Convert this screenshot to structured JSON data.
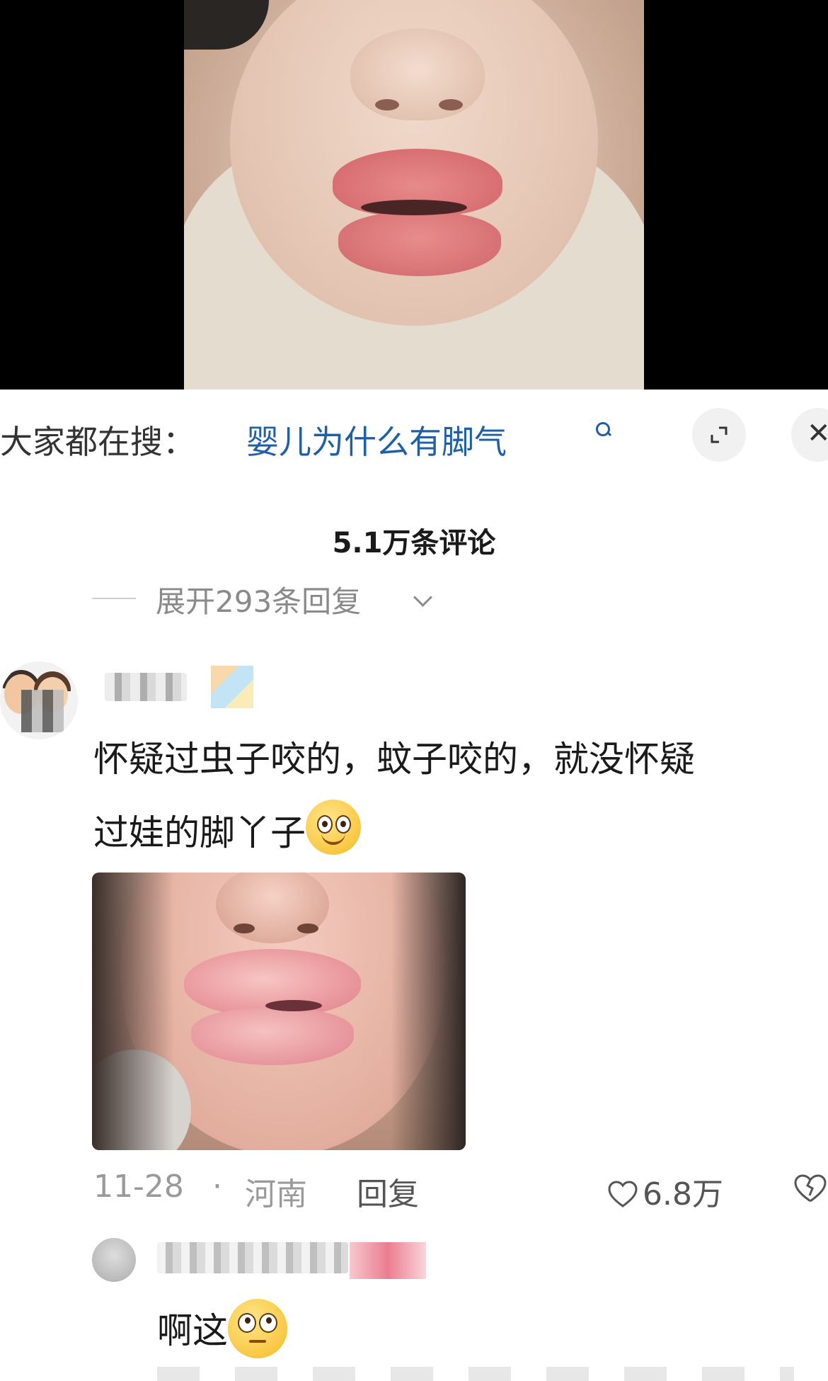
{
  "search": {
    "prefix": "大家都在搜：",
    "term": "婴儿为什么有脚气"
  },
  "comments": {
    "count_label": "5.1万条评论",
    "expand_label": "展开293条回复",
    "main": {
      "text_line1": "怀疑过虫子咬的，蚊子咬的，就没怀疑",
      "text_line2": "过娃的脚丫子",
      "date": "11-28",
      "dot": "·",
      "location": "河南",
      "reply_label": "回复",
      "likes": "6.8万"
    },
    "reply": {
      "text": "啊这"
    }
  },
  "icons": {
    "search": "search-icon",
    "expand": "expand-icon",
    "close": "close-icon",
    "chevron": "chevron-down-icon",
    "heart": "heart-icon",
    "dislike": "broken-heart-icon"
  },
  "colors": {
    "link": "#1f5fa8",
    "muted": "#9a9a9a"
  }
}
